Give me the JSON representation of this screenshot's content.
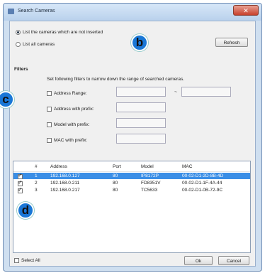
{
  "window": {
    "title": "Search Cameras"
  },
  "title_controls": {
    "close_glyph": "✕"
  },
  "options": {
    "list_not_inserted": "List the cameras which are not inserted",
    "list_all": "List all cameras",
    "selected": "list_not_inserted"
  },
  "refresh_label": "Refresh",
  "filters": {
    "title": "Filters",
    "hint": "Set following filters to narrow down the range of searched cameras.",
    "address_range": "Address Range:",
    "address_prefix": "Address with prefix:",
    "model_prefix": "Model with prefix:",
    "mac_prefix": "MAC with prefix:",
    "range_separator": "~",
    "address_range_from": "",
    "address_range_to": "",
    "address_prefix_value": "",
    "model_prefix_value": "",
    "mac_prefix_value": ""
  },
  "table": {
    "columns": [
      "#",
      "Address",
      "Port",
      "Model",
      "MAC"
    ],
    "rows": [
      {
        "checked": true,
        "num": "1",
        "address": "192.168.0.127",
        "port": "80",
        "model": "IP8172P",
        "mac": "00-02-D1-2D-8B-4D",
        "selected": true
      },
      {
        "checked": true,
        "num": "2",
        "address": "192.168.0.211",
        "port": "80",
        "model": "FD8351V",
        "mac": "00-02-D1-1F-4A-44",
        "selected": false
      },
      {
        "checked": true,
        "num": "3",
        "address": "192.168.0.217",
        "port": "80",
        "model": "TC5633",
        "mac": "00-02-D1-0B-72-9C",
        "selected": false
      }
    ]
  },
  "select_all_label": "Select All",
  "ok_label": "Ok",
  "cancel_label": "Cancel",
  "callouts": {
    "b": "b",
    "c": "c",
    "d": "d"
  },
  "colors": {
    "selection": "#3a8ee6",
    "badge": "#1977d6",
    "close": "#c7402c"
  }
}
